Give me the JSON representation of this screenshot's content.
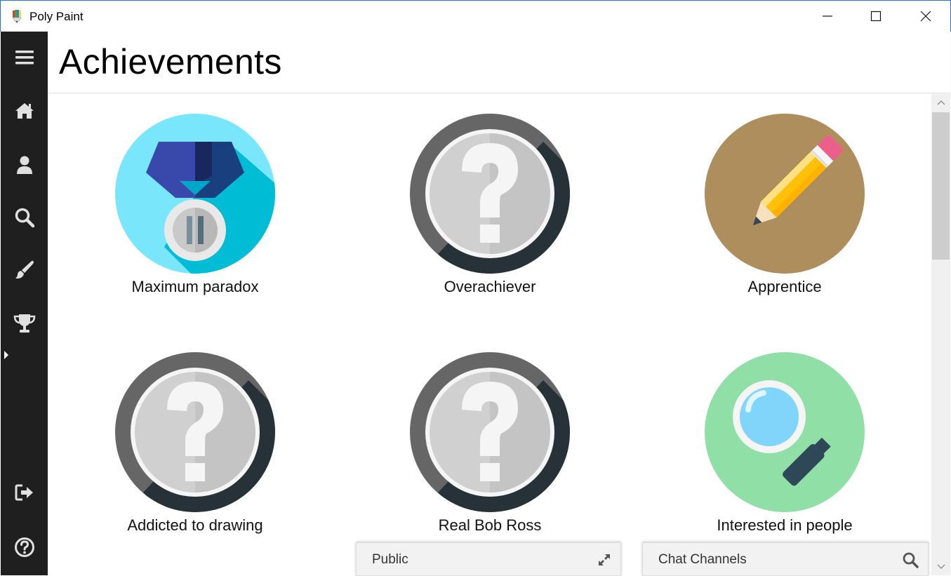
{
  "window": {
    "title": "Poly Paint",
    "minimize_icon": "minimize-icon",
    "maximize_icon": "maximize-icon",
    "close_icon": "close-icon"
  },
  "sidebar": {
    "items": [
      {
        "icon": "hamburger-menu-icon"
      },
      {
        "icon": "home-icon"
      },
      {
        "icon": "user-icon"
      },
      {
        "icon": "search-icon"
      },
      {
        "icon": "paint-brush-icon"
      },
      {
        "icon": "trophy-icon",
        "active": true
      },
      {
        "icon": "logout-icon"
      },
      {
        "icon": "help-icon"
      }
    ]
  },
  "header": {
    "title": "Achievements"
  },
  "achievements": [
    {
      "label": "Maximum paradox",
      "icon": "medal-icon",
      "unlocked": true
    },
    {
      "label": "Overachiever",
      "icon": "question-mark-icon",
      "unlocked": false
    },
    {
      "label": "Apprentice",
      "icon": "pencil-icon",
      "unlocked": true
    },
    {
      "label": "Addicted to drawing",
      "icon": "question-mark-icon",
      "unlocked": false
    },
    {
      "label": "Real Bob Ross",
      "icon": "question-mark-icon",
      "unlocked": false
    },
    {
      "label": "Interested in people",
      "icon": "magnifier-icon",
      "unlocked": true
    }
  ],
  "chat": {
    "public_label": "Public",
    "channels_label": "Chat Channels"
  },
  "colors": {
    "sidebar_bg": "#1f1f1f",
    "medal_bg": "#7ae6fb",
    "pencil_bg": "#ae8e5c",
    "magnifier_bg": "#8fdfa6",
    "locked_ring": "#666666"
  }
}
